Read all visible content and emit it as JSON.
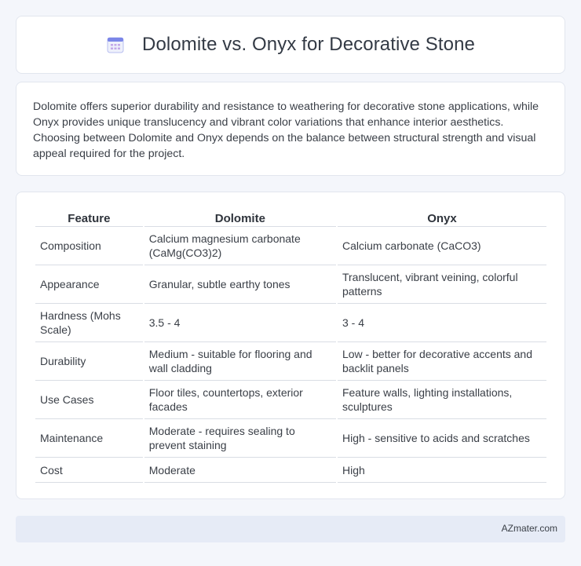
{
  "header": {
    "title": "Dolomite vs. Onyx for Decorative Stone",
    "icon": "calendar-icon"
  },
  "summary": {
    "text": "Dolomite offers superior durability and resistance to weathering for decorative stone applications, while Onyx provides unique translucency and vibrant color variations that enhance interior aesthetics. Choosing between Dolomite and Onyx depends on the balance between structural strength and visual appeal required for the project."
  },
  "table": {
    "headers": [
      "Feature",
      "Dolomite",
      "Onyx"
    ],
    "rows": [
      [
        "Composition",
        "Calcium magnesium carbonate (CaMg(CO3)2)",
        "Calcium carbonate (CaCO3)"
      ],
      [
        "Appearance",
        "Granular, subtle earthy tones",
        "Translucent, vibrant veining, colorful patterns"
      ],
      [
        "Hardness (Mohs Scale)",
        "3.5 - 4",
        "3 - 4"
      ],
      [
        "Durability",
        "Medium - suitable for flooring and wall cladding",
        "Low - better for decorative accents and backlit panels"
      ],
      [
        "Use Cases",
        "Floor tiles, countertops, exterior facades",
        "Feature walls, lighting installations, sculptures"
      ],
      [
        "Maintenance",
        "Moderate - requires sealing to prevent staining",
        "High - sensitive to acids and scratches"
      ],
      [
        "Cost",
        "Moderate",
        "High"
      ]
    ]
  },
  "footer": {
    "text": "AZmater.com"
  },
  "colors": {
    "background": "#f4f6fb",
    "card": "#ffffff",
    "footer": "#e6ebf6",
    "icon_accent": "#7b86e8"
  }
}
